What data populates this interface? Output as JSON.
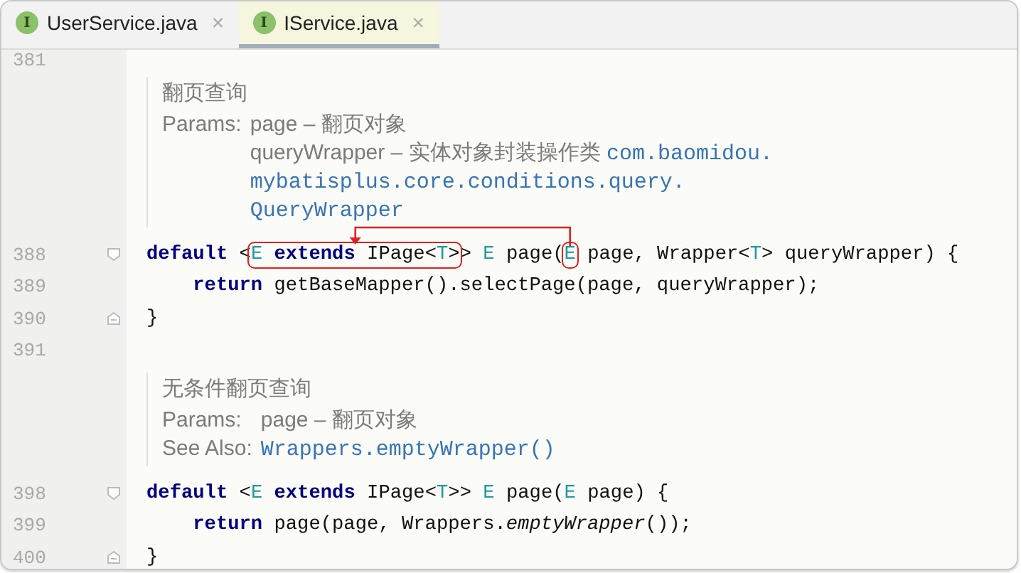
{
  "tabs": [
    {
      "icon_letter": "I",
      "label": "UserService.java",
      "close": "×",
      "selected": false
    },
    {
      "icon_letter": "I",
      "label": "IService.java",
      "close": "×",
      "selected": true
    }
  ],
  "editor": [
    {
      "kind": "code",
      "number": "381",
      "fold_start": false,
      "fold_end": false,
      "indented": false,
      "callout_arrow": false
    },
    {
      "kind": "doc",
      "title": "翻页查询",
      "rows": [
        {
          "label": "Params:",
          "segments": [
            {
              "kind": "plain",
              "text": "page – 翻页对象"
            }
          ]
        },
        {
          "segments": [
            {
              "kind": "plain",
              "text": "queryWrapper – 实体对象封装操作类 "
            },
            {
              "kind": "link",
              "text": "com.baomidou."
            }
          ]
        },
        {
          "segments": [
            {
              "kind": "link",
              "text": "mybatisplus.core.conditions.query."
            }
          ]
        },
        {
          "segments": [
            {
              "kind": "link",
              "text": "QueryWrapper"
            }
          ]
        }
      ]
    },
    {
      "kind": "code",
      "number": "388",
      "fold_start": true,
      "fold_end": false,
      "indented": false,
      "callout_arrow": true,
      "tokens": [
        {
          "kind": "keyword",
          "text": "default"
        },
        {
          "kind": "plain",
          "text": " <"
        },
        {
          "kind": "boxed",
          "tokens": [
            {
              "kind": "type_param",
              "text": "E"
            },
            {
              "kind": "keyword",
              "text": " extends"
            },
            {
              "kind": "plain",
              "text": " IPage<"
            },
            {
              "kind": "type_param",
              "text": "T"
            },
            {
              "kind": "plain",
              "text": ">"
            }
          ]
        },
        {
          "kind": "plain",
          "text": "> "
        },
        {
          "kind": "type_param",
          "text": "E"
        },
        {
          "kind": "plain",
          "text": " page("
        },
        {
          "kind": "boxed",
          "tokens": [
            {
              "kind": "type_param",
              "text": "E"
            }
          ]
        },
        {
          "kind": "plain",
          "text": " page, Wrapper<"
        },
        {
          "kind": "type_param",
          "text": "T"
        },
        {
          "kind": "plain",
          "text": "> queryWrapper) {"
        }
      ]
    },
    {
      "kind": "code",
      "number": "389",
      "fold_start": false,
      "fold_end": false,
      "indented": true,
      "callout_arrow": false,
      "tokens": [
        {
          "kind": "keyword",
          "text": "return"
        },
        {
          "kind": "plain",
          "text": " getBaseMapper().selectPage(page, queryWrapper);"
        }
      ]
    },
    {
      "kind": "code",
      "number": "390",
      "fold_start": false,
      "fold_end": true,
      "indented": false,
      "callout_arrow": false,
      "tokens": [
        {
          "kind": "plain",
          "text": "}"
        }
      ]
    },
    {
      "kind": "code",
      "number": "391",
      "fold_start": false,
      "fold_end": false,
      "indented": false,
      "callout_arrow": false
    },
    {
      "kind": "doc",
      "title": "无条件翻页查询",
      "rows": [
        {
          "label": "Params:",
          "segments": [
            {
              "kind": "plain",
              "text": "page – 翻页对象"
            }
          ]
        },
        {
          "label": "See Also:",
          "segments": [
            {
              "kind": "link",
              "text": "Wrappers.emptyWrapper()"
            }
          ]
        }
      ]
    },
    {
      "kind": "code",
      "number": "398",
      "fold_start": true,
      "fold_end": false,
      "indented": false,
      "callout_arrow": false,
      "tokens": [
        {
          "kind": "keyword",
          "text": "default"
        },
        {
          "kind": "plain",
          "text": " <"
        },
        {
          "kind": "type_param",
          "text": "E"
        },
        {
          "kind": "keyword",
          "text": " extends"
        },
        {
          "kind": "plain",
          "text": " IPage<"
        },
        {
          "kind": "type_param",
          "text": "T"
        },
        {
          "kind": "plain",
          "text": ">> "
        },
        {
          "kind": "type_param",
          "text": "E"
        },
        {
          "kind": "plain",
          "text": " page("
        },
        {
          "kind": "type_param",
          "text": "E"
        },
        {
          "kind": "plain",
          "text": " page) {"
        }
      ]
    },
    {
      "kind": "code",
      "number": "399",
      "fold_start": false,
      "fold_end": false,
      "indented": true,
      "callout_arrow": false,
      "tokens": [
        {
          "kind": "keyword",
          "text": "return"
        },
        {
          "kind": "plain",
          "text": " page(page, Wrappers."
        },
        {
          "kind": "italic",
          "text": "emptyWrapper"
        },
        {
          "kind": "plain",
          "text": "());"
        }
      ]
    },
    {
      "kind": "code",
      "number": "400",
      "fold_start": false,
      "fold_end": true,
      "indented": false,
      "callout_arrow": false,
      "tokens": [
        {
          "kind": "plain",
          "text": "}"
        }
      ]
    }
  ]
}
